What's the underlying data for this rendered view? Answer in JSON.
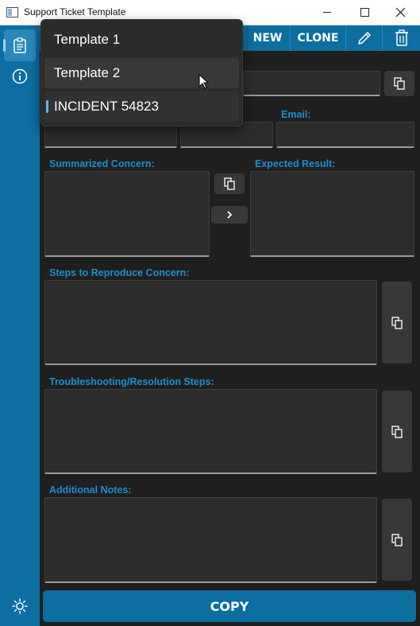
{
  "window": {
    "title": "Support Ticket Template",
    "buttons": {
      "minimize": "minimize-icon",
      "maximize": "maximize-icon",
      "close": "close-icon"
    }
  },
  "sidebar": {
    "items": [
      {
        "name": "templates",
        "icon": "clipboard-icon",
        "selected": true
      },
      {
        "name": "about",
        "icon": "info-icon"
      },
      {
        "name": "theme",
        "icon": "sun-icon"
      }
    ]
  },
  "toolbar": {
    "new_label": "NEW",
    "clone_label": "CLONE",
    "edit_icon": "pencil-icon",
    "delete_icon": "trash-icon"
  },
  "template_dropdown": {
    "items": [
      "Template 1",
      "Template 2",
      "INCIDENT 54823"
    ],
    "selected": "INCIDENT 54823",
    "hovered": "Template 2"
  },
  "form": {
    "email_label": "Email:",
    "summarized_concern_label": "Summarized Concern:",
    "expected_result_label": "Expected Result:",
    "steps_label": "Steps to Reproduce Concern:",
    "troubleshooting_label": "Troubleshooting/Resolution Steps:",
    "notes_label": "Additional Notes:"
  },
  "copy_label": "COPY",
  "colors": {
    "accent": "#0d6ea1",
    "label": "#1a8fd1",
    "background": "#1f1f1f",
    "field": "#2d2d2d"
  }
}
